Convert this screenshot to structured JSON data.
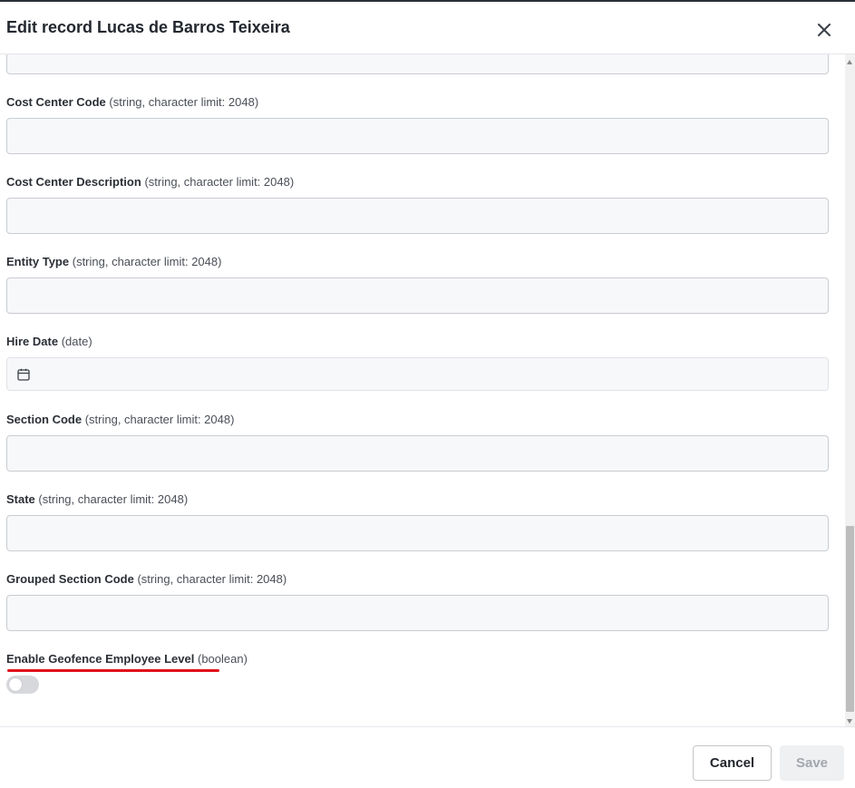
{
  "dialog": {
    "title": "Edit record Lucas de Barros Teixeira",
    "close_icon": "close-icon"
  },
  "fields": [
    {
      "name": "Cost Center Code",
      "meta": "(string, character limit: 2048)",
      "value": ""
    },
    {
      "name": "Cost Center Description",
      "meta": "(string, character limit: 2048)",
      "value": ""
    },
    {
      "name": "Entity Type",
      "meta": "(string, character limit: 2048)",
      "value": ""
    },
    {
      "name": "Hire Date",
      "meta": "(date)",
      "value": "",
      "icon": "calendar-icon"
    },
    {
      "name": "Section Code",
      "meta": "(string, character limit: 2048)",
      "value": ""
    },
    {
      "name": "State",
      "meta": "(string, character limit: 2048)",
      "value": ""
    },
    {
      "name": "Grouped Section Code",
      "meta": "(string, character limit: 2048)",
      "value": ""
    },
    {
      "name": "Enable Geofence Employee Level",
      "meta": "(boolean)",
      "checked": false
    }
  ],
  "footer": {
    "cancel_label": "Cancel",
    "save_label": "Save"
  },
  "colors": {
    "annotation_underline": "#e0101a",
    "input_background": "#f7f8fa",
    "save_disabled_text": "#a3a7ad"
  }
}
